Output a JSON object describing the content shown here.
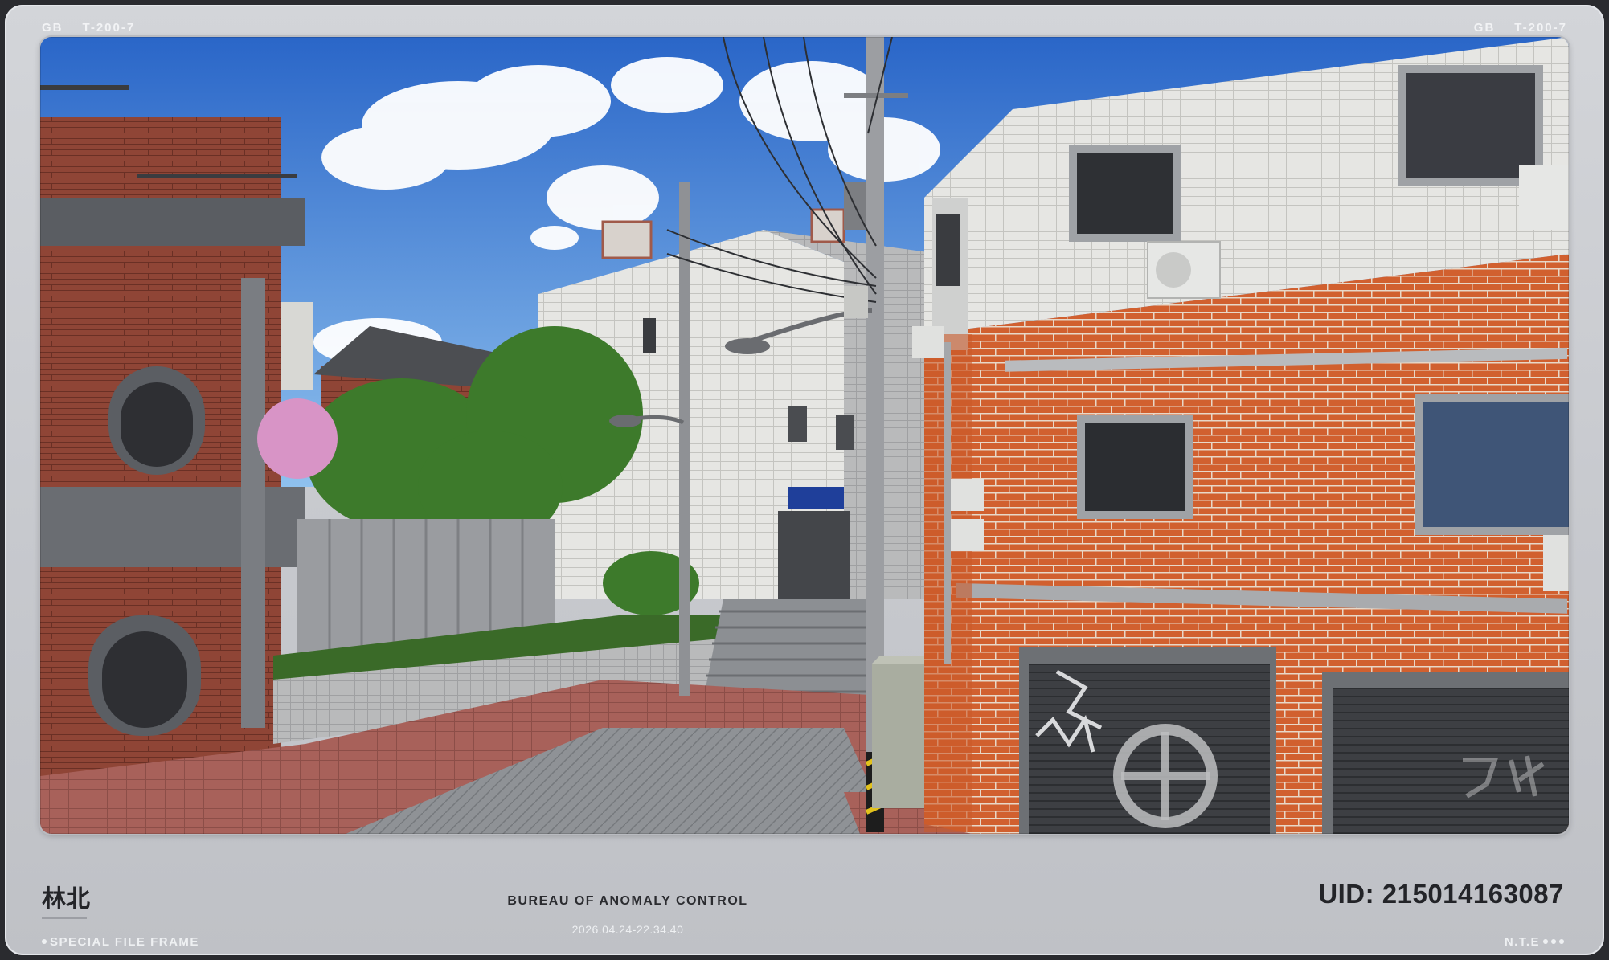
{
  "header": {
    "left_code_a": "GB",
    "left_code_b": "T-200-7",
    "right_code_a": "GB",
    "right_code_b": "T-200-7"
  },
  "scene": {
    "shutter_symbol_text": "",
    "colors": {
      "sky_top": "#2f6fd0",
      "sky_bottom": "#8ec0ef",
      "brick_orange": "#d4612f",
      "brick_red": "#9a4636",
      "tile_white": "#e8e8e6",
      "concrete": "#9a9ca0",
      "foliage": "#3f7a2c"
    }
  },
  "footer": {
    "location": "林北",
    "left_caption": "SPECIAL FILE FRAME",
    "organization": "BUREAU OF ANOMALY CONTROL",
    "timestamp": "2026.04.24-22.34.40",
    "uid": "UID: 215014163087",
    "right_caption": "N.T.E"
  }
}
